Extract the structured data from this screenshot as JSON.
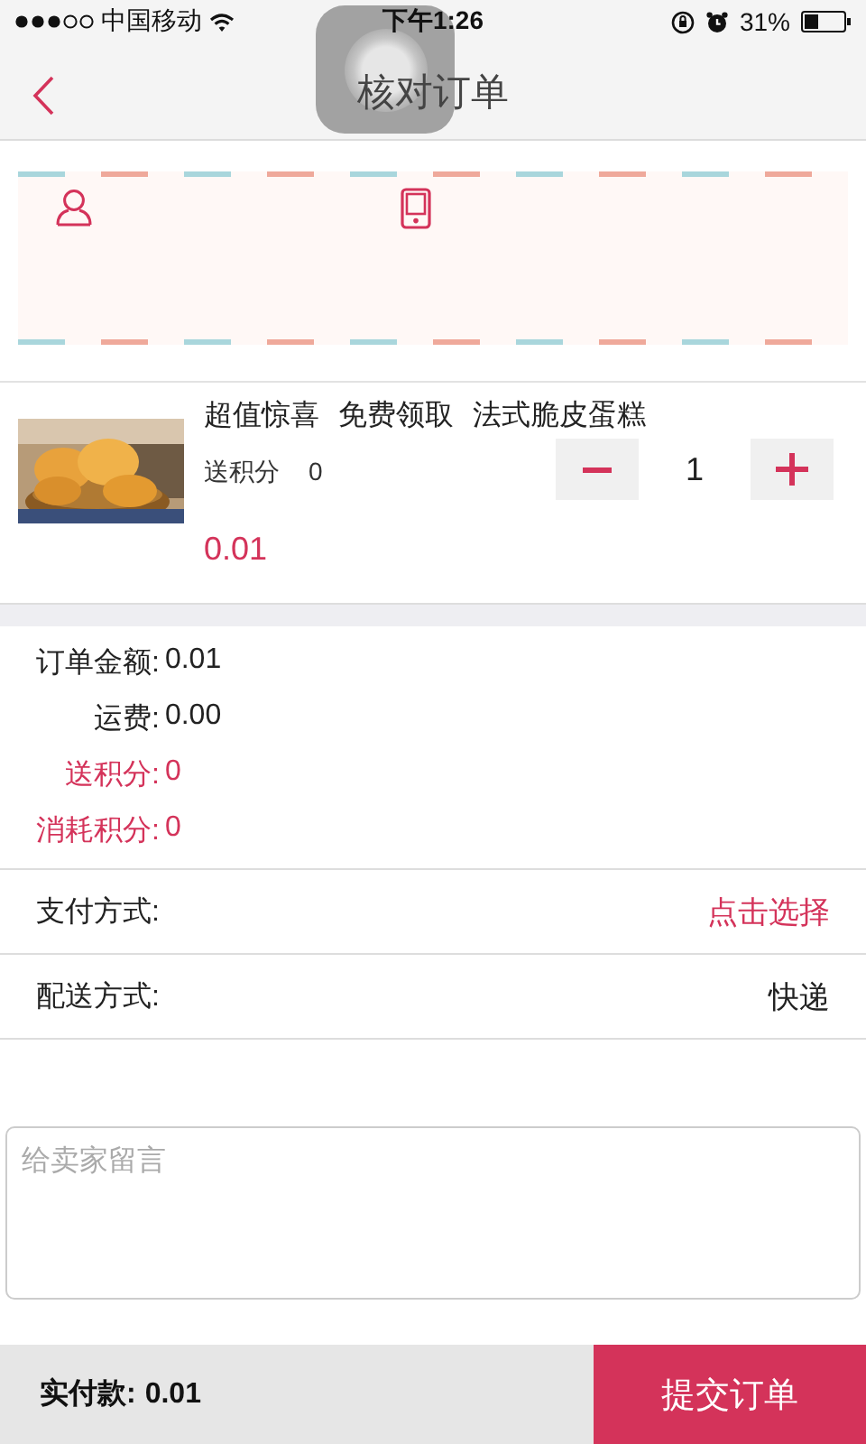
{
  "status_bar": {
    "carrier": "中国移动",
    "time": "下午1:26",
    "battery": "31%"
  },
  "nav": {
    "title": "核对订单"
  },
  "product": {
    "title": "超值惊喜 免费领取 法式脆皮蛋糕",
    "points_label": "送积分",
    "points": "0",
    "price": "0.01",
    "quantity": "1"
  },
  "summary": [
    {
      "label": "订单金额:",
      "value": "0.01",
      "highlight": false
    },
    {
      "label": "运费:",
      "value": "0.00",
      "highlight": false
    },
    {
      "label": "送积分:",
      "value": "0",
      "highlight": true
    },
    {
      "label": "消耗积分:",
      "value": "0",
      "highlight": true
    }
  ],
  "options": [
    {
      "label": "支付方式:",
      "value": "点击选择",
      "highlight": true
    },
    {
      "label": "配送方式:",
      "value": "快递",
      "highlight": false
    }
  ],
  "message": {
    "placeholder": "给卖家留言"
  },
  "footer": {
    "total_label": "实付款:",
    "total": "0.01",
    "submit": "提交订单"
  }
}
